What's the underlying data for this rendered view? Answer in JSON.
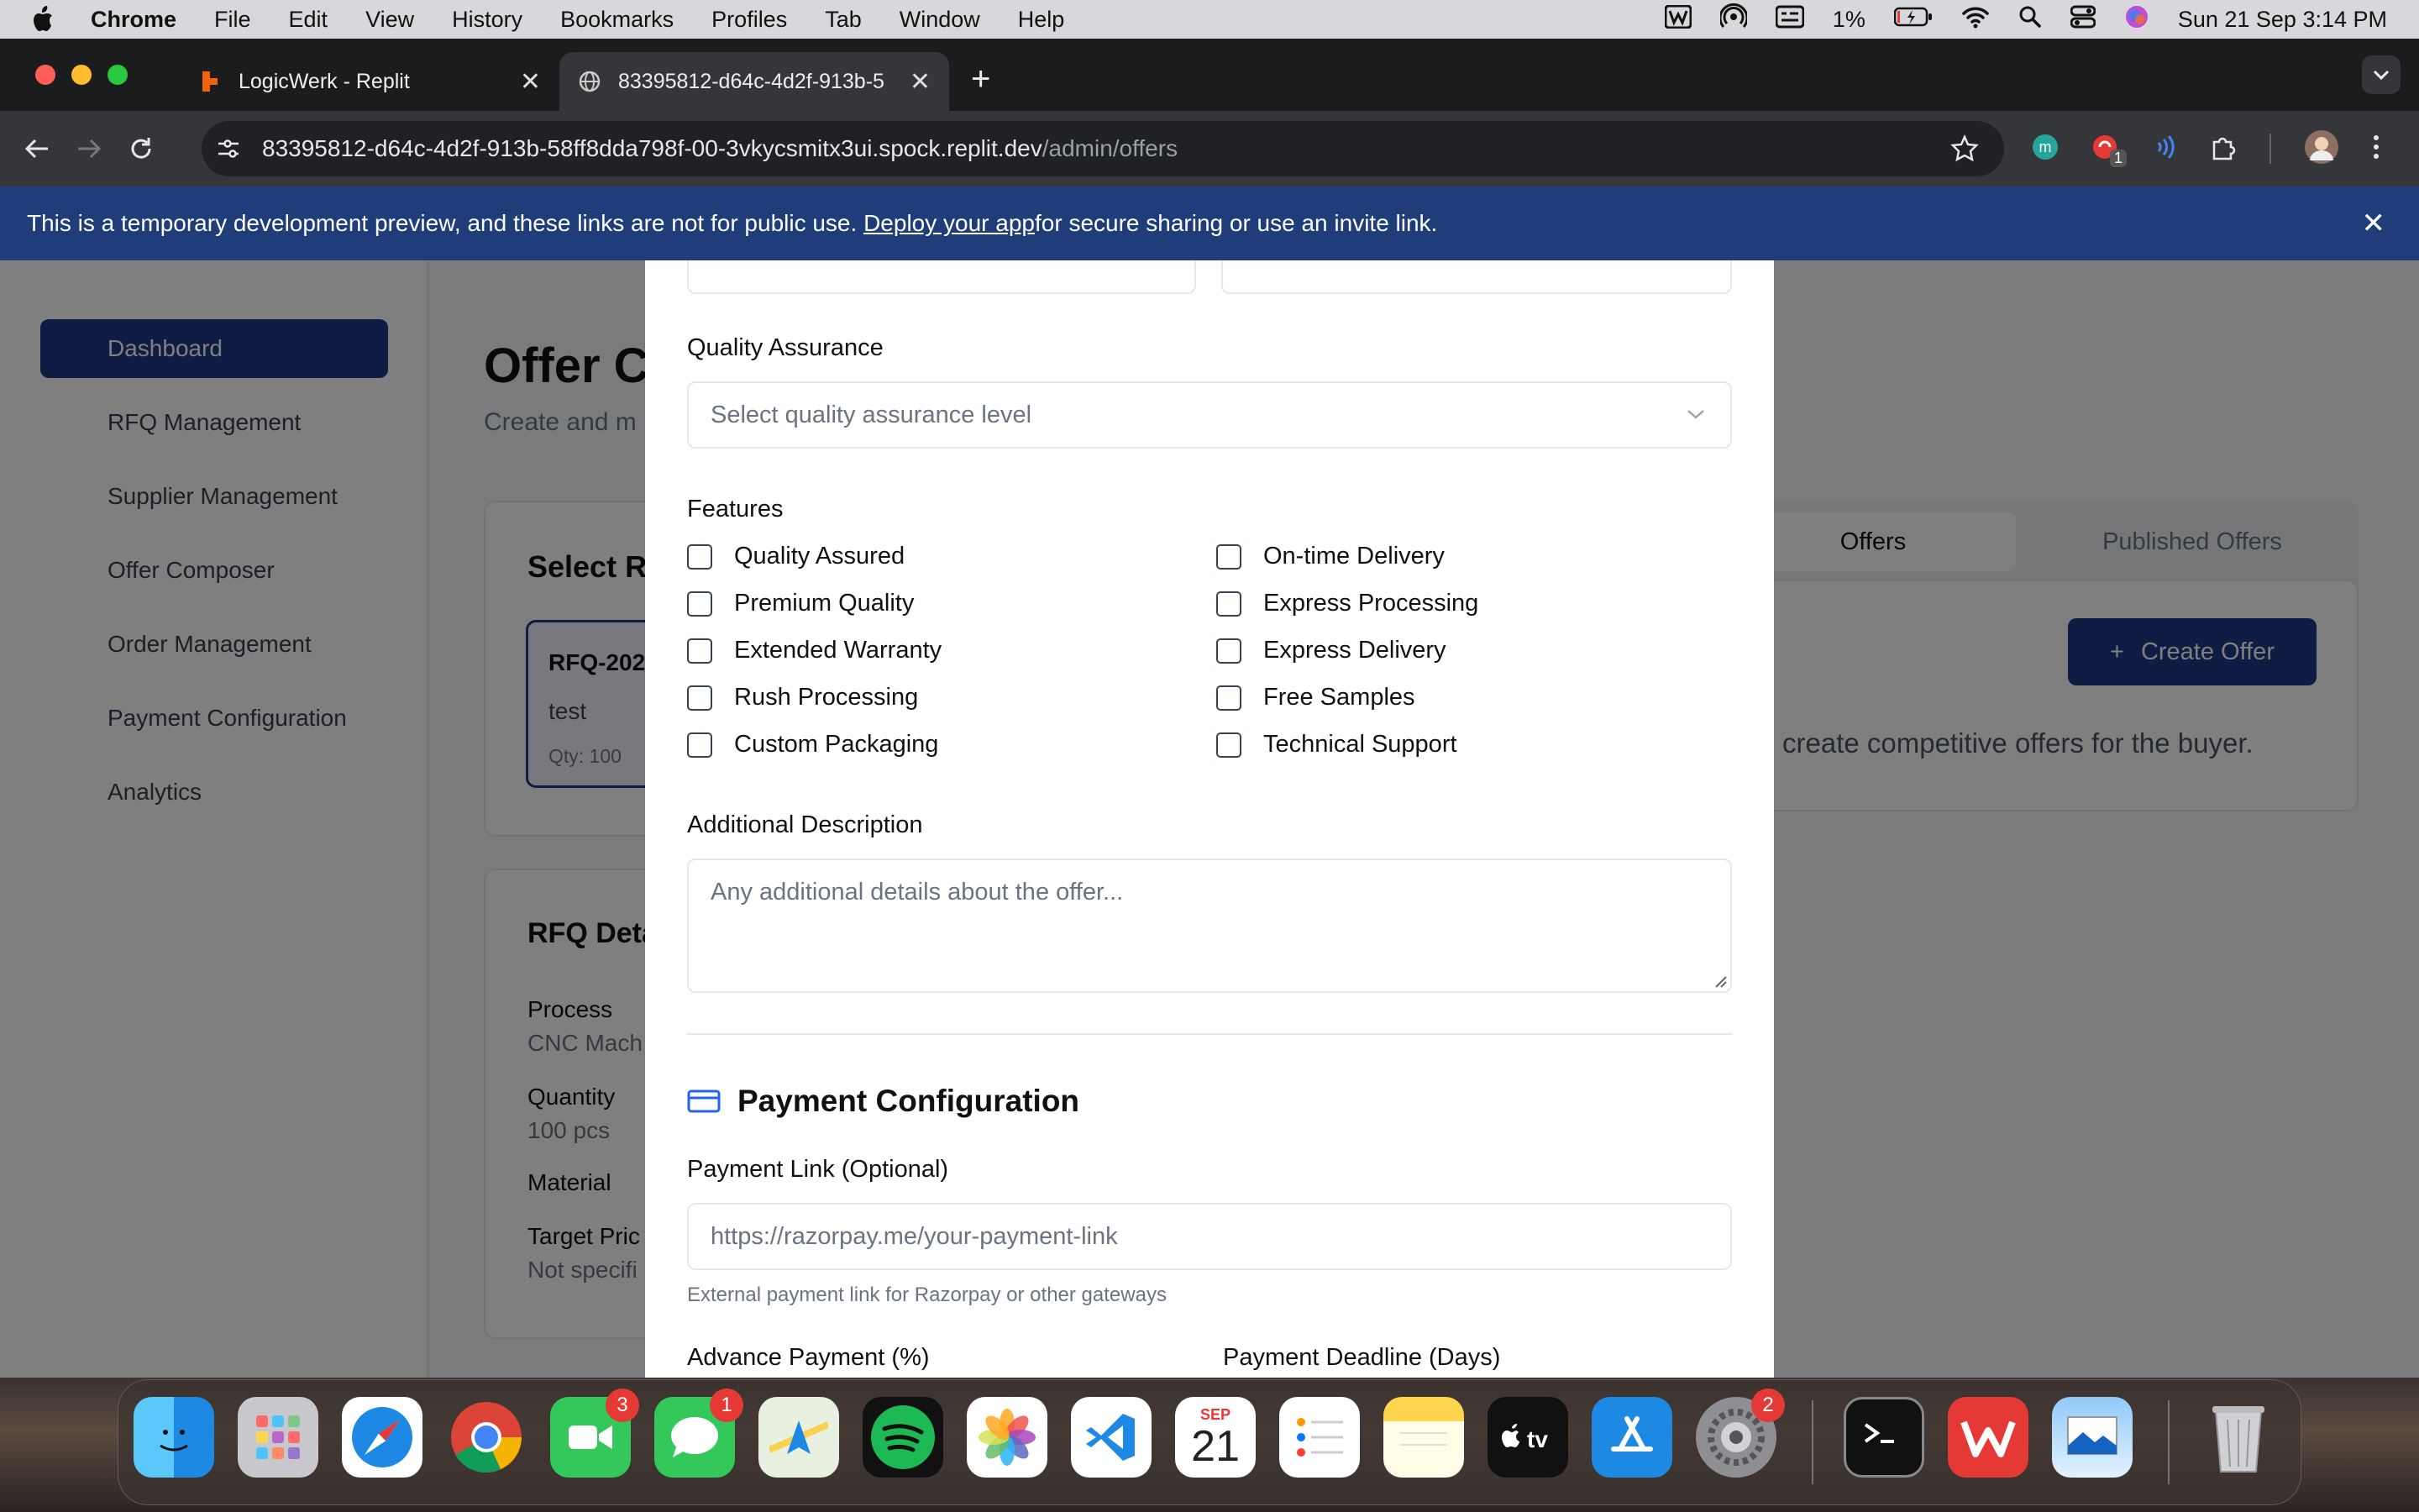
{
  "menubar": {
    "app": "Chrome",
    "items": [
      "File",
      "Edit",
      "View",
      "History",
      "Bookmarks",
      "Profiles",
      "Tab",
      "Window",
      "Help"
    ],
    "battery": "1%",
    "datetime": "Sun 21 Sep  3:14 PM"
  },
  "tabs": [
    {
      "title": "LogicWerk - Replit"
    },
    {
      "title": "83395812-d64c-4d2f-913b-5"
    }
  ],
  "url": {
    "host": "83395812-d64c-4d2f-913b-58ff8dda798f-00-3vkycsmitx3ui.spock.replit.dev",
    "path": "/admin/offers"
  },
  "extensions": {
    "badge": "1"
  },
  "banner": {
    "text_before": "This is a temporary development preview, and these links are not for public use.",
    "link": "Deploy your app",
    "text_after": " for secure sharing or use an invite link."
  },
  "sidebar": {
    "items": [
      {
        "label": "Dashboard",
        "active": true
      },
      {
        "label": "RFQ Management"
      },
      {
        "label": "Supplier Management"
      },
      {
        "label": "Offer Composer"
      },
      {
        "label": "Order Management"
      },
      {
        "label": "Payment Configuration"
      },
      {
        "label": "Analytics"
      }
    ]
  },
  "background": {
    "page_title": "Offer C",
    "page_subtitle": "Create and m",
    "select_rfq_title": "Select RI",
    "rfq_card": {
      "id": "RFQ-202",
      "desc": "test",
      "qty": "Qty: 100"
    },
    "tabs": [
      "Offers",
      "Published Offers"
    ],
    "create_offer": "Create Offer",
    "empty_hint": "create competitive offers for the buyer.",
    "rfq_details_title": "RFQ Deta",
    "details": [
      {
        "label": "Process",
        "value": "CNC Mach"
      },
      {
        "label": "Quantity",
        "value": "100 pcs"
      },
      {
        "label": "Material",
        "value": ""
      },
      {
        "label": "Target Pric",
        "value": "Not specifi"
      }
    ]
  },
  "modal": {
    "quality": {
      "label": "Quality Assurance",
      "placeholder": "Select quality assurance level"
    },
    "features": {
      "label": "Features",
      "left": [
        "Quality Assured",
        "Premium Quality",
        "Extended Warranty",
        "Rush Processing",
        "Custom Packaging"
      ],
      "right": [
        "On-time Delivery",
        "Express Processing",
        "Express Delivery",
        "Free Samples",
        "Technical Support"
      ]
    },
    "additional": {
      "label": "Additional Description",
      "placeholder": "Any additional details about the offer..."
    },
    "payment": {
      "heading": "Payment Configuration",
      "link_label": "Payment Link (Optional)",
      "link_placeholder": "https://razorpay.me/your-payment-link",
      "link_help": "External payment link for Razorpay or other gateways",
      "advance_label": "Advance Payment (%)",
      "deadline_label": "Payment Deadline (Days)"
    }
  },
  "dock": {
    "badges": {
      "facetime": "3",
      "messages": "1",
      "settings": "2"
    },
    "calendar": {
      "month": "SEP",
      "day": "21"
    }
  },
  "colors": {
    "accent": "#1e3a8a",
    "banner": "#1f3d78",
    "payment_icon": "#2563eb"
  }
}
